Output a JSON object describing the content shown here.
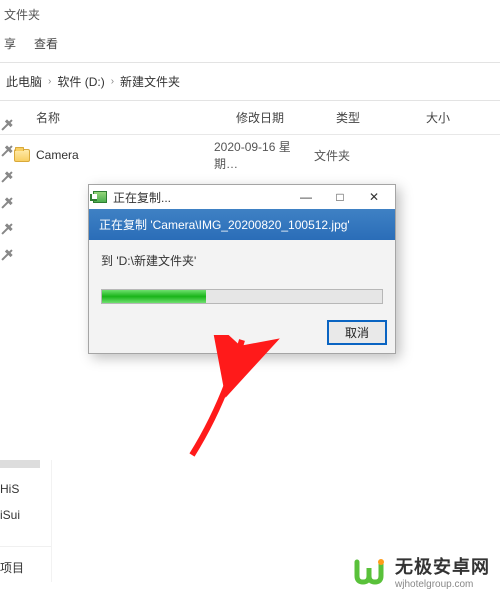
{
  "window": {
    "title_suffix": "文件夹"
  },
  "toolbar": {
    "share": "享",
    "view": "查看"
  },
  "breadcrumb": {
    "root": "此电脑",
    "drive": "软件 (D:)",
    "folder": "新建文件夹"
  },
  "columns": {
    "name": "名称",
    "date": "修改日期",
    "type": "类型",
    "size": "大小"
  },
  "rows": [
    {
      "name": "Camera",
      "date": "2020-09-16 星期…",
      "type": "文件夹",
      "size": ""
    }
  ],
  "sidebar": {
    "item1": "HiS",
    "item2": "iSui",
    "footer": "项目"
  },
  "dialog": {
    "title": "正在复制...",
    "banner": "正在复制 'Camera\\IMG_20200820_100512.jpg'",
    "destination": "到 'D:\\新建文件夹'",
    "progress_percent": 37,
    "cancel": "取消"
  },
  "watermark": {
    "title": "无极安卓网",
    "sub": "wjhotelgroup.com"
  },
  "icons": {
    "minimize": "—",
    "maximize": "□",
    "close": "✕"
  },
  "colors": {
    "accent": "#0a64c2",
    "progress": "#19b419",
    "banner": "#2a6db8"
  }
}
